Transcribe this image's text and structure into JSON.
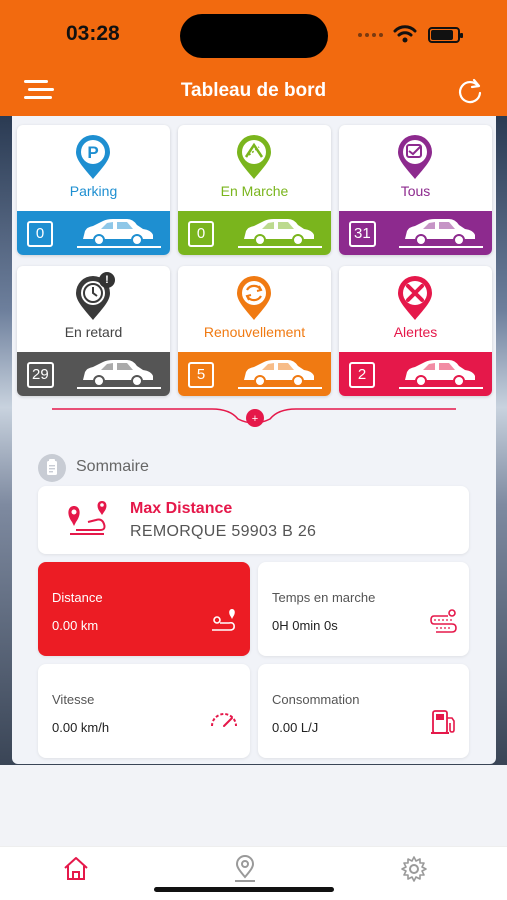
{
  "status_bar": {
    "time": "03:28"
  },
  "header": {
    "title": "Tableau de bord"
  },
  "tiles": [
    {
      "label": "Parking",
      "count": "0",
      "color": "#1e8fd1",
      "label_color": "#1e8fd1",
      "icon": "parking-icon"
    },
    {
      "label": "En Marche",
      "count": "0",
      "color": "#7ab51d",
      "label_color": "#7ab51d",
      "icon": "running-icon"
    },
    {
      "label": "Tous",
      "count": "31",
      "color": "#8d2a8e",
      "label_color": "#8d2a8e",
      "icon": "all-vehicles-icon"
    },
    {
      "label": "En retard",
      "count": "29",
      "color": "#555555",
      "label_color": "#444444",
      "icon": "late-clock-icon"
    },
    {
      "label": "Renouvellement",
      "count": "5",
      "color": "#f07a12",
      "label_color": "#f07a12",
      "icon": "renewal-icon"
    },
    {
      "label": "Alertes",
      "count": "2",
      "color": "#e5184a",
      "label_color": "#e5184a",
      "icon": "alert-icon"
    }
  ],
  "summary": {
    "title": "Sommaire",
    "max_distance": {
      "title": "Max Distance",
      "vehicle": "REMORQUE 59903 B 26"
    },
    "stats": [
      {
        "label": "Distance",
        "value": "0.00 km",
        "icon": "route-icon",
        "highlight": true
      },
      {
        "label": "Temps en marche",
        "value": "0H 0min 0s",
        "icon": "road-trip-icon",
        "highlight": false
      },
      {
        "label": "Vitesse",
        "value": "0.00 km/h",
        "icon": "speedometer-icon",
        "highlight": false
      },
      {
        "label": "Consommation",
        "value": "0.00 L/J",
        "icon": "fuel-icon",
        "highlight": false
      }
    ]
  },
  "tabbar": {
    "tabs": [
      {
        "name": "home",
        "icon": "home-icon",
        "active": true
      },
      {
        "name": "map",
        "icon": "map-pin-icon",
        "active": false
      },
      {
        "name": "settings",
        "icon": "gear-icon",
        "active": false
      }
    ],
    "active_color": "#e5184a",
    "inactive_color": "#9a9a9a"
  },
  "colors": {
    "brand_orange": "#f26a0f",
    "accent_red": "#e5184a"
  }
}
